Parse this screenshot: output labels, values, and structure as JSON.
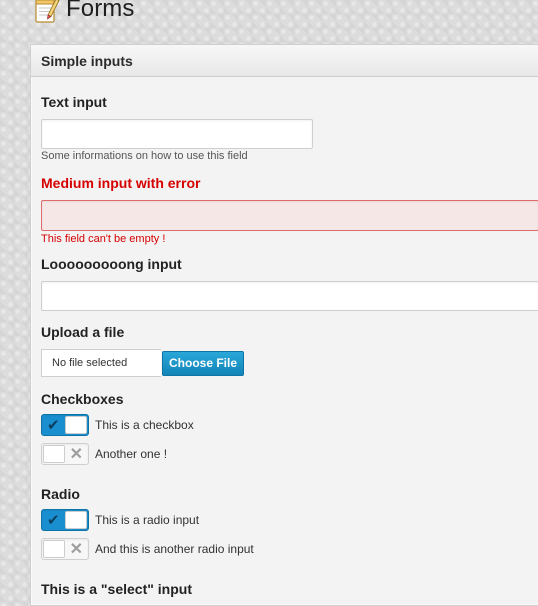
{
  "page": {
    "title": "Forms",
    "icon": "notepad-pencil-icon"
  },
  "panel": {
    "title": "Simple inputs"
  },
  "fields": {
    "text_input": {
      "label": "Text input",
      "value": "",
      "help": "Some informations on how to use this field"
    },
    "medium_error": {
      "label": "Medium input with error",
      "value": "",
      "error": "This field can't be empty !"
    },
    "long_input": {
      "label": "Looooooooong input",
      "value": ""
    },
    "upload": {
      "label": "Upload a file",
      "status": "No file selected",
      "button": "Choose File"
    },
    "checkboxes": {
      "label": "Checkboxes",
      "items": [
        {
          "label": "This is a checkbox",
          "checked": true
        },
        {
          "label": "Another one !",
          "checked": false
        }
      ]
    },
    "radio": {
      "label": "Radio",
      "items": [
        {
          "label": "This is a radio input",
          "checked": true
        },
        {
          "label": "And this is another radio input",
          "checked": false
        }
      ]
    },
    "select": {
      "label": "This is a \"select\" input"
    }
  },
  "colors": {
    "accent": "#1a8fd0",
    "error": "#d60000",
    "error_bg": "#f6e7e7"
  }
}
